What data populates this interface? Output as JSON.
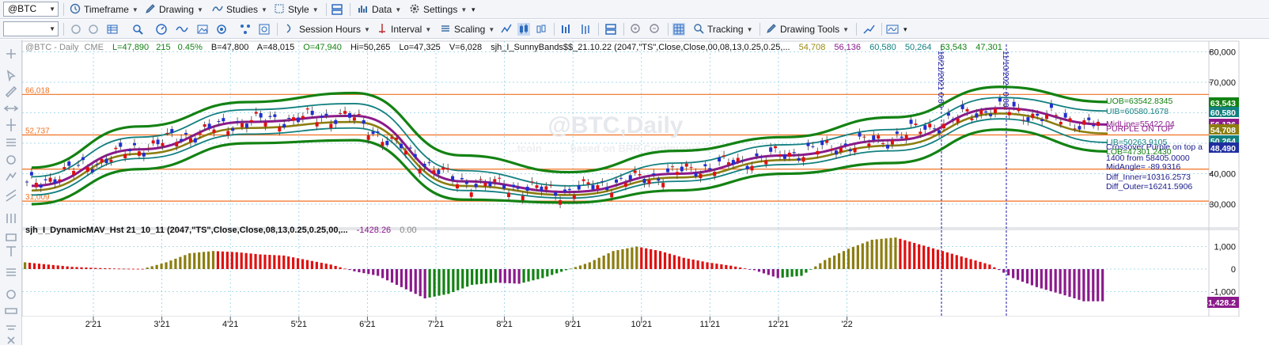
{
  "toolbar_top": {
    "symbol": "@BTC",
    "timeframe": "Timeframe",
    "drawing": "Drawing",
    "studies": "Studies",
    "style": "Style",
    "data": "Data",
    "settings": "Settings"
  },
  "toolbar_bottom": {
    "session_hours": "Session Hours",
    "interval": "Interval",
    "scaling": "Scaling",
    "tracking": "Tracking",
    "drawing_tools": "Drawing Tools"
  },
  "price_pane": {
    "symbol_label": "@BTC - Daily",
    "exchange": "CME",
    "last": "L=47,890",
    "change": "215",
    "change_pct": "0.45%",
    "bid": "B=47,800",
    "ask": "A=48,015",
    "open": "O=47,940",
    "high": "Hi=50,265",
    "low": "Lo=47,325",
    "volume": "V=6,028",
    "study_name": "sjh_I_SunnyBands$$_21.10.22 (2047,\"TS\",Close,Close,00,08,13,0.25,0.25,...",
    "study_values": [
      {
        "v": "54,708",
        "color": "#9a8a12"
      },
      {
        "v": "56,136",
        "color": "#8b1a8b"
      },
      {
        "v": "60,580",
        "color": "#138080"
      },
      {
        "v": "50,264",
        "color": "#138080"
      },
      {
        "v": "63,543",
        "color": "#138213"
      },
      {
        "v": "47,301",
        "color": "#138213"
      }
    ],
    "watermark": "@BTC,Daily",
    "watermark_sub": "...tcoin ........ based on BRR Continuous Co...",
    "hlines": [
      "66,018",
      "52,737",
      "31,009"
    ],
    "vline_labels": [
      "10/21/2021 0:00",
      "11/10/2021 0:00"
    ],
    "y_ticks": [
      "80,000",
      "70,000",
      "60,000",
      "50,000",
      "40,000",
      "30,000"
    ],
    "right_tags": [
      {
        "text": "63,543",
        "bg": "#138213"
      },
      {
        "text": "60,580",
        "bg": "#138080"
      },
      {
        "text": "56,136",
        "bg": "#8b1a8b"
      },
      {
        "text": "54,708",
        "bg": "#8c7d10"
      },
      {
        "text": "50,264",
        "bg": "#138080"
      },
      {
        "text": "48,490",
        "bg": "#1f2fa0"
      }
    ],
    "annotations": [
      {
        "text": "UOB=63542.8345",
        "color": "#138213"
      },
      {
        "text": "UIB=60580.1678",
        "color": "#138080"
      },
      {
        "text": "MidLine=55422.04",
        "color": "#8b1a8b"
      },
      {
        "text": "PURPLE ON TOP",
        "color": "#8b1a8b"
      },
      {
        "text": "LIB=50263.9105",
        "color": "#138080"
      },
      {
        "text": "Crossover Purple on top a",
        "color": "#1a1a8c"
      },
      {
        "text": "LOB=47301.2430",
        "color": "#138213"
      },
      {
        "text": "1400 from 58405.0000",
        "color": "#1a1a8c"
      },
      {
        "text": "MidAngle= -89.9316",
        "color": "#1a1a8c"
      },
      {
        "text": "Diff_Inner=10316.2573",
        "color": "#1a1a8c"
      },
      {
        "text": "Diff_Outer=16241.5906",
        "color": "#1a1a8c"
      }
    ]
  },
  "sub_pane": {
    "study_name": "sjh_I_DynamicMAV_Hst 21_10_11 (2047,\"TS\",Close,Close,08,13,0.25,0.25,00,...",
    "value": "-1428.26",
    "value2": "0.00",
    "y_ticks": [
      "1,000",
      "0",
      "-1,000"
    ],
    "right_tag": "-1,428.2"
  },
  "x_axis": [
    "2'21",
    "3'21",
    "4'21",
    "5'21",
    "6'21",
    "7'21",
    "8'21",
    "9'21",
    "10'21",
    "11'21",
    "12'21",
    "'22"
  ],
  "colors": {
    "outer_band": "#138213",
    "inner_band": "#138080",
    "midline": "#8b1a8b",
    "mav": "#8c7d10",
    "candle_up": "#1f2fd0",
    "candle_down": "#e01010",
    "hline": "#f07020",
    "vline": "#1a1aa0"
  },
  "chart_data": {
    "type": "line",
    "title": "@BTC - Daily",
    "ylim": [
      28000,
      82000
    ],
    "x": [
      "2'21",
      "3'21",
      "4'21",
      "5'21",
      "6'21",
      "7'21",
      "8'21",
      "9'21",
      "10'21",
      "11'21",
      "12'21"
    ],
    "series": [
      {
        "name": "UOB",
        "values": [
          42000,
          55500,
          63500,
          66500,
          46000,
          40500,
          47500,
          52000,
          58500,
          68500,
          63543
        ]
      },
      {
        "name": "UIB",
        "values": [
          39000,
          52000,
          61000,
          63000,
          41000,
          36000,
          43500,
          49500,
          54500,
          65000,
          60580
        ]
      },
      {
        "name": "MidLine",
        "values": [
          36000,
          48000,
          57000,
          59000,
          37500,
          34000,
          40000,
          46000,
          51000,
          61500,
          56136
        ]
      },
      {
        "name": "LIB",
        "values": [
          33000,
          45000,
          53000,
          55000,
          34500,
          32000,
          37500,
          43000,
          47500,
          58000,
          50264
        ]
      },
      {
        "name": "LOB",
        "values": [
          30000,
          41500,
          50000,
          51000,
          31500,
          30500,
          34500,
          40000,
          43500,
          54500,
          47301
        ]
      }
    ],
    "histogram": {
      "name": "sjh_I_DynamicMAV_Hst",
      "ylim": [
        -1800,
        1800
      ],
      "values": [
        300,
        200,
        100,
        50,
        20,
        10,
        300,
        700,
        800,
        750,
        650,
        600,
        400,
        200,
        -100,
        -300,
        -800,
        -1300,
        -1100,
        -700,
        -600,
        -650,
        -400,
        -50,
        300,
        800,
        1000,
        800,
        500,
        300,
        150,
        -50,
        -400,
        -300,
        400,
        900,
        1300,
        1400,
        1100,
        800,
        500,
        200,
        -400,
        -800,
        -1100,
        -1428
      ]
    }
  }
}
